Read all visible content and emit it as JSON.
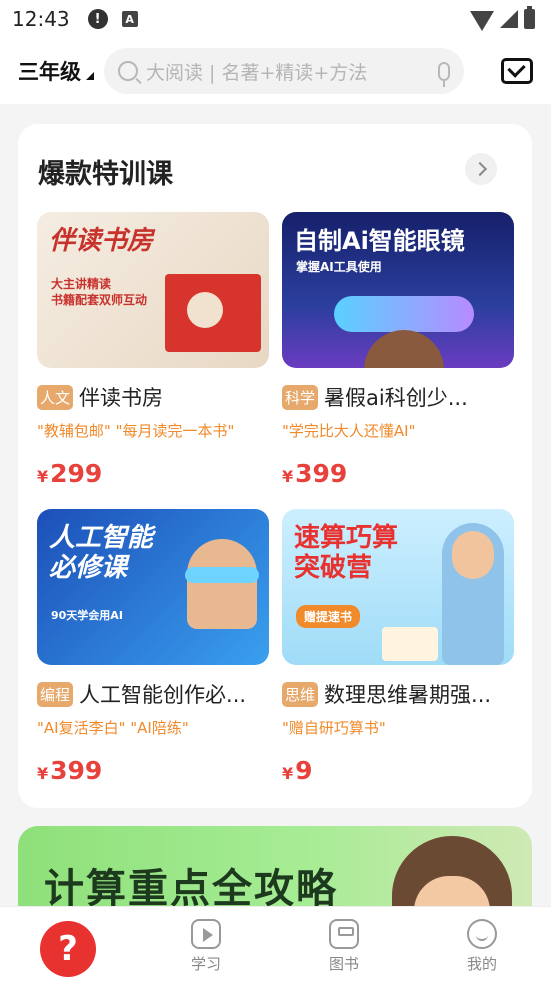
{
  "status_bar": {
    "time": "12:43",
    "notif_icon": "!",
    "app_icon": "A"
  },
  "header": {
    "grade": "三年级",
    "search_placeholder": "大阅读 | 名著+精读+方法"
  },
  "section": {
    "title": "爆款特训课",
    "courses": [
      {
        "tag": "人文",
        "title": "伴读书房",
        "subtitle": "\"教辅包邮\" \"每月读完一本书\"",
        "currency": "¥",
        "price": "299",
        "thumb_title": "伴读书房",
        "thumb_sub": "大主讲精读\n书籍配套双师互动",
        "thumb_bg": "#efe6dc",
        "thumb_color": "#c8322c"
      },
      {
        "tag": "科学",
        "title": "暑假ai科创少...",
        "subtitle": "\"学完比大人还懂AI\"",
        "currency": "¥",
        "price": "399",
        "thumb_title": "自制Ai智能眼镜",
        "thumb_sub": "掌握AI工具使用",
        "thumb_bg": "#1a2a6e",
        "thumb_color": "#ffffff"
      },
      {
        "tag": "编程",
        "title": "人工智能创作必...",
        "subtitle": "\"AI复活李白\" \"AI陪练\"",
        "currency": "¥",
        "price": "399",
        "thumb_title": "人工智能\n必修课",
        "thumb_sub": "90天学会用AI",
        "thumb_bg": "#1f5fd6",
        "thumb_color": "#ffffff"
      },
      {
        "tag": "思维",
        "title": "数理思维暑期强...",
        "subtitle": "\"赠自研巧算书\"",
        "currency": "¥",
        "price": "9",
        "thumb_title": "速算巧算\n突破营",
        "thumb_sub": "赠提速书",
        "thumb_bg": "#bfe7fb",
        "thumb_color": "#e8322f"
      }
    ]
  },
  "banner": {
    "text": "计算重点全攻略"
  },
  "bottom_nav": {
    "home_icon": "?",
    "items": [
      {
        "label": "学习"
      },
      {
        "label": "图书"
      },
      {
        "label": "我的"
      }
    ]
  }
}
